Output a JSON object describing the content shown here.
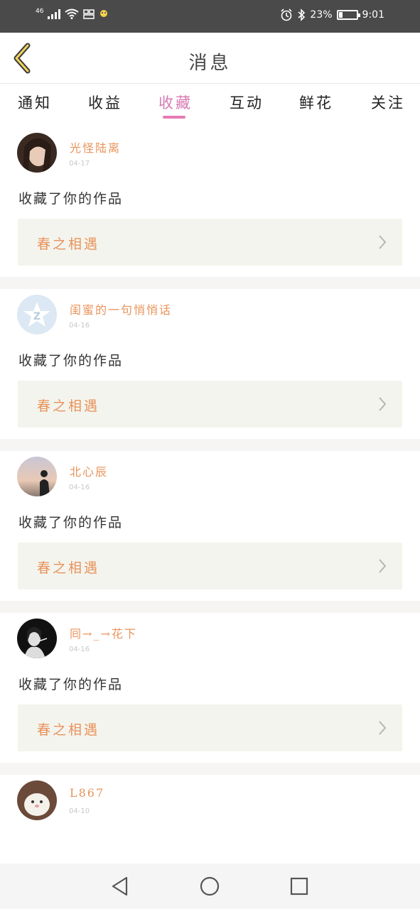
{
  "status_bar": {
    "network": "46",
    "battery": "23%",
    "time": "9:01",
    "battery_level": 0.23,
    "icons": [
      "signal-icon",
      "wifi-icon",
      "hd-call-icon",
      "notification-icon",
      "alarm-icon",
      "bluetooth-icon",
      "battery-icon"
    ]
  },
  "header": {
    "title": "消息",
    "back_icon": "chevron-left-icon"
  },
  "tabs": [
    {
      "label": "通知",
      "active": false
    },
    {
      "label": "收益",
      "active": false
    },
    {
      "label": "收藏",
      "active": true
    },
    {
      "label": "互动",
      "active": false
    },
    {
      "label": "鲜花",
      "active": false
    },
    {
      "label": "关注",
      "active": false
    }
  ],
  "messages": [
    {
      "user": "光怪陆离",
      "date": "04-17",
      "action": "收藏了你的作品",
      "work": "春之相遇"
    },
    {
      "user": "闺蜜的一句悄悄话",
      "date": "04-16",
      "action": "收藏了你的作品",
      "work": "春之相遇"
    },
    {
      "user": "北心辰",
      "date": "04-16",
      "action": "收藏了你的作品",
      "work": "春之相遇"
    },
    {
      "user": "囘→_→花下",
      "date": "04-16",
      "action": "收藏了你的作品",
      "work": "春之相遇"
    },
    {
      "user": "L867",
      "date": "04-10"
    }
  ],
  "colors": {
    "accent": "#e77ab3",
    "username": "#e8935a",
    "work_bg": "#f4f4ee",
    "status_bar_bg": "#4a4a4a"
  },
  "nav_bar": {
    "icons": [
      "back-triangle-icon",
      "home-circle-icon",
      "recents-square-icon"
    ]
  }
}
